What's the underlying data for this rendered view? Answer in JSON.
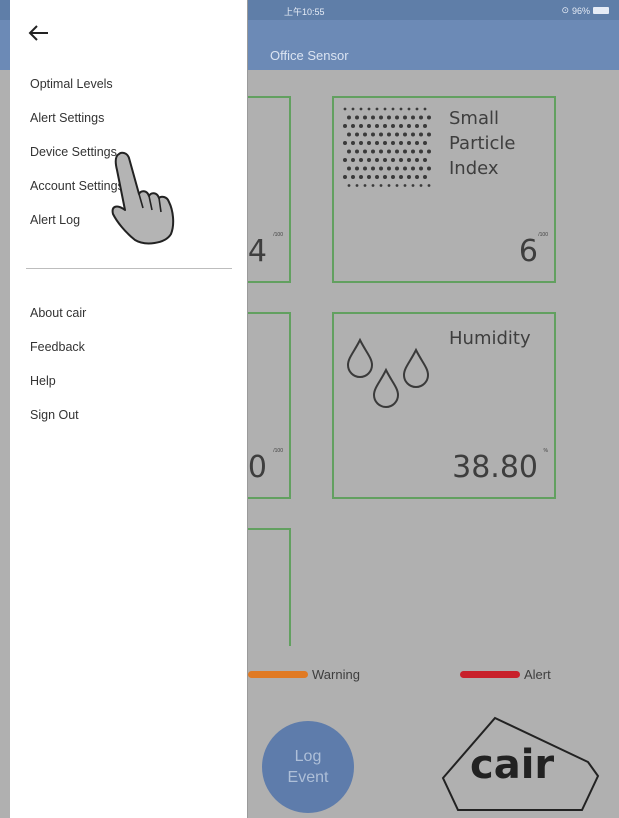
{
  "status_bar": {
    "time": "上午10:55",
    "battery": "96%"
  },
  "header": {
    "title": "Office Sensor"
  },
  "cards": [
    {
      "name": "Small Particle Index",
      "name_lines": [
        "Small",
        "Particle",
        "Index"
      ],
      "value": "6",
      "unit": "/100"
    },
    {
      "name": "Humidity",
      "value": "38.80",
      "unit": "%"
    },
    {
      "value": "4",
      "unit": "/100"
    },
    {
      "value": "0",
      "unit": "/100"
    }
  ],
  "legend": {
    "warning": {
      "label": "Warning",
      "color": "#e07a24"
    },
    "alert": {
      "label": "Alert",
      "color": "#c8202a"
    }
  },
  "log_event": {
    "line1": "Log",
    "line2": "Event"
  },
  "logo": {
    "text": "cair"
  },
  "drawer": {
    "menu_primary": [
      {
        "label": "Optimal Levels"
      },
      {
        "label": "Alert Settings"
      },
      {
        "label": "Device Settings"
      },
      {
        "label": "Account Settings"
      },
      {
        "label": "Alert Log"
      }
    ],
    "menu_secondary": [
      {
        "label": "About cair"
      },
      {
        "label": "Feedback"
      },
      {
        "label": "Help"
      },
      {
        "label": "Sign Out"
      }
    ]
  },
  "colors": {
    "accent": "#6c8ab6",
    "card_border": "#62a060",
    "overlay": "#b0b0b0"
  }
}
